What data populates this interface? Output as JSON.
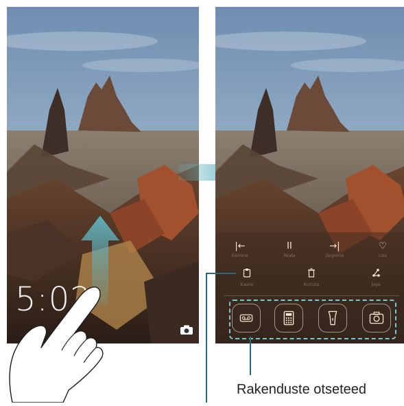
{
  "lockscreen": {
    "clock": "5:02"
  },
  "magazine_panel": {
    "controls_row1": [
      {
        "icon": "rewind-icon",
        "glyph": "|←",
        "label": "Eelmine"
      },
      {
        "icon": "pause-icon",
        "glyph": "II",
        "label": "Peata"
      },
      {
        "icon": "next-icon",
        "glyph": "→|",
        "label": "Järgmine"
      },
      {
        "icon": "heart-icon",
        "glyph": "♡",
        "label": "Lisa"
      }
    ],
    "controls_row2": [
      {
        "icon": "clipboard-icon",
        "label": "Kaane"
      },
      {
        "icon": "trash-icon",
        "label": "Kustuta"
      },
      {
        "icon": "share-icon",
        "label": "Jaga"
      }
    ]
  },
  "shortcuts": [
    {
      "icon": "recorder-icon"
    },
    {
      "icon": "calculator-icon"
    },
    {
      "icon": "flashlight-icon"
    },
    {
      "icon": "camera-icon"
    }
  ],
  "callout": {
    "label": "Rakenduste otseteed"
  },
  "colors": {
    "accent": "#7ec7d1",
    "arrow": "#5fb3be",
    "callout_line": "#1f6f7c"
  }
}
